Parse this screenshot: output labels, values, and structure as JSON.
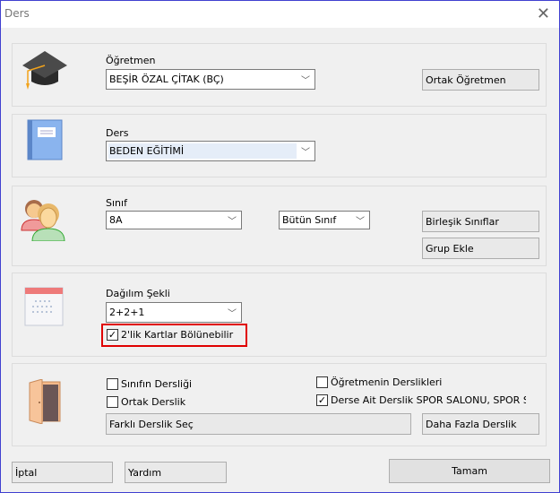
{
  "window": {
    "title": "Ders",
    "close_icon": "close-icon",
    "border_color": "#4040d0"
  },
  "teacher": {
    "label": "Öğretmen",
    "value": "BEŞİR ÖZAL ÇİTAK (BÇ)",
    "button": "Ortak Öğretmen",
    "icon": "graduation-cap-icon"
  },
  "lesson": {
    "label": "Ders",
    "value": "BEDEN EĞİTİMİ",
    "icon": "book-icon"
  },
  "class": {
    "label": "Sınıf",
    "value": "8A",
    "scope": "Bütün Sınıf",
    "buttons": [
      "Birleşik Sınıflar",
      "Grup Ekle"
    ],
    "icon": "people-icon"
  },
  "distribution": {
    "label": "Dağılım Şekli",
    "value": "2+2+1",
    "checkbox": {
      "label": "2'lik Kartlar Bölünebilir",
      "checked": true
    },
    "highlight_color": "#e00000",
    "icon": "calendar-icon"
  },
  "classroom": {
    "icon": "door-icon",
    "checkboxes": [
      {
        "label": "Sınıfın Dersliği",
        "checked": false
      },
      {
        "label": "Ortak Derslik",
        "checked": false
      },
      {
        "label": "Öğretmenin Derslikleri",
        "checked": false
      },
      {
        "label": "Derse Ait Derslik SPOR SALONU, SPOR SALON",
        "checked": true
      }
    ],
    "buttons": [
      "Farklı Derslik Seç",
      "Daha Fazla Derslik"
    ]
  },
  "footer": {
    "cancel": "İptal",
    "help": "Yardım",
    "ok": "Tamam"
  }
}
